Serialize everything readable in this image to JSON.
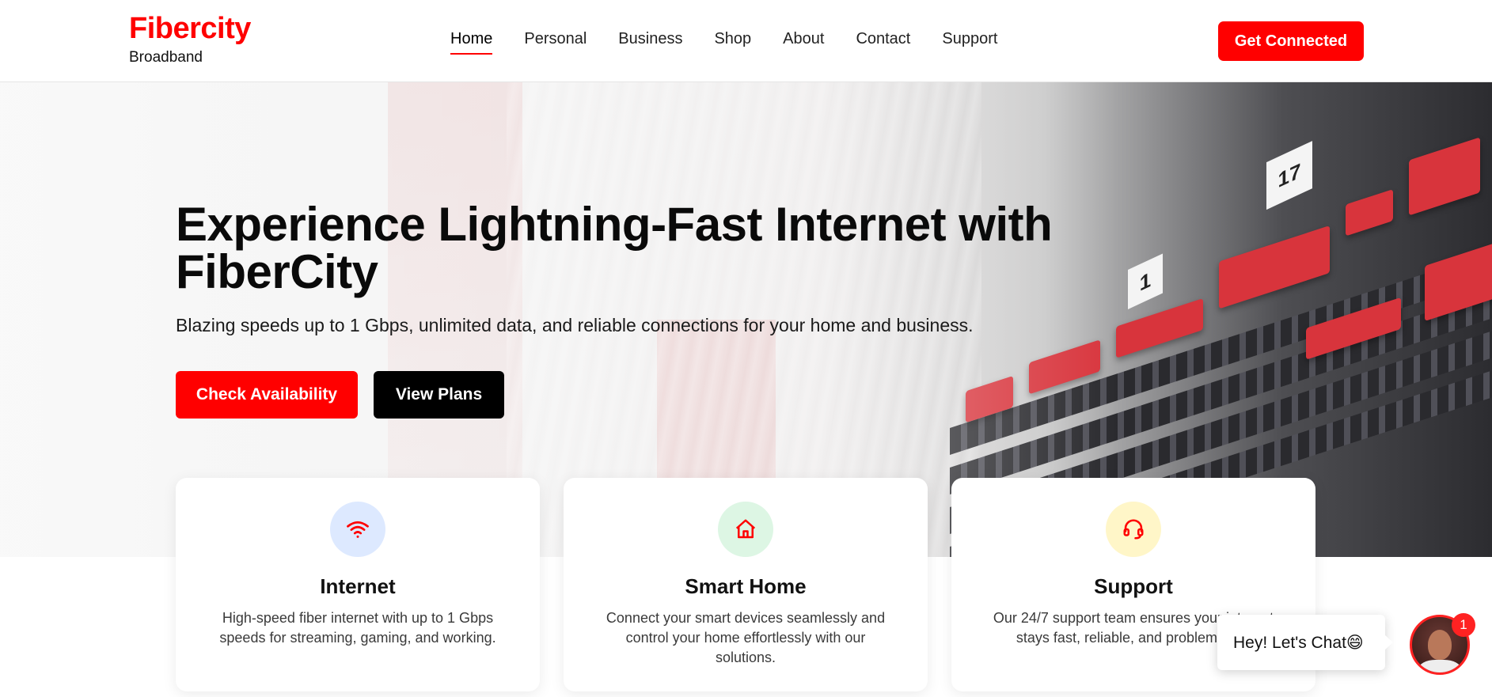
{
  "brand": {
    "name": "Fibercity",
    "tagline": "Broadband",
    "accent_color": "#ff0000"
  },
  "nav": {
    "items": [
      {
        "label": "Home",
        "active": true
      },
      {
        "label": "Personal"
      },
      {
        "label": "Business"
      },
      {
        "label": "Shop"
      },
      {
        "label": "About"
      },
      {
        "label": "Contact"
      },
      {
        "label": "Support"
      }
    ],
    "cta_label": "Get Connected"
  },
  "hero": {
    "title": "Experience Lightning-Fast Internet with FiberCity",
    "subtitle": "Blazing speeds up to 1 Gbps, unlimited data, and reliable connections for your home and business.",
    "primary_button": "Check Availability",
    "secondary_button": "View Plans",
    "rack_labels": [
      "1",
      "17"
    ]
  },
  "cards": [
    {
      "icon": "wifi-icon",
      "icon_bg": "#dde9ff",
      "title": "Internet",
      "description": "High-speed fiber internet with up to 1 Gbps speeds for streaming, gaming, and working."
    },
    {
      "icon": "home-icon",
      "icon_bg": "#ddf6e4",
      "title": "Smart Home",
      "description": "Connect your smart devices seamlessly and control your home effortlessly with our solutions."
    },
    {
      "icon": "headset-icon",
      "icon_bg": "#fff6c8",
      "title": "Support",
      "description": "Our 24/7 support team ensures your internet stays fast, reliable, and problem-free."
    }
  ],
  "chat": {
    "message": "Hey! Let's Chat😄",
    "badge_count": "1"
  }
}
